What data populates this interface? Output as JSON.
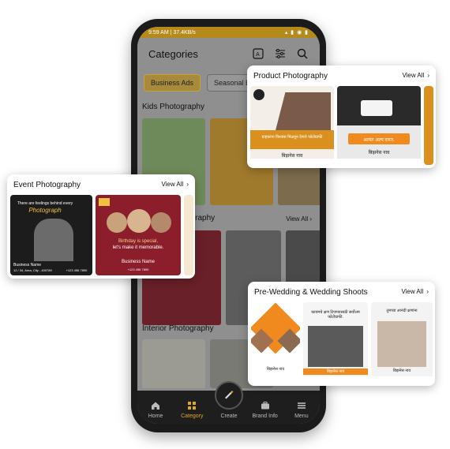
{
  "status": {
    "time": "9:59 AM | 37.4KB/s",
    "indicators": "▴ ▮ ◉ ▮"
  },
  "appbar": {
    "title": "Categories"
  },
  "chips": [
    {
      "label": "Business Ads"
    },
    {
      "label": "Seasonal B"
    }
  ],
  "sections": [
    {
      "title": "Kids Photography",
      "view_all": ""
    },
    {
      "title": "ography",
      "view_all": "View All"
    },
    {
      "title": "Interior Photography",
      "view_all": ""
    }
  ],
  "bottom_nav": [
    {
      "label": "Home",
      "icon": "home-icon"
    },
    {
      "label": "Category",
      "icon": "category-icon"
    },
    {
      "label": "Create",
      "icon": "create-icon"
    },
    {
      "label": "Brand Info",
      "icon": "briefcase-icon"
    },
    {
      "label": "Menu",
      "icon": "menu-icon"
    }
  ],
  "cards": {
    "product": {
      "title": "Product Photography",
      "view_all": "View All",
      "poster1_text": "ग्राहकांना विश्वास मिळवून देणारे फोटोग्राफी",
      "poster1_name": "बिझनेस नाव",
      "poster2_text": "अत्यंत अल्प दरात.",
      "poster2_name": "बिझनेस नाव"
    },
    "event": {
      "title": "Event Photography",
      "view_all": "View All",
      "poster1_top": "There are feelings behind every",
      "poster1_script": "Photograph",
      "poster1_name": "Business Name",
      "poster1_addr": "12 / 34, Area, City - 400789",
      "poster1_phone": "+123 456 7890",
      "poster2_line1": "Birthday is special,",
      "poster2_line2": "let's make it memorable.",
      "poster2_name": "Business Name",
      "poster2_phone": "+123 456 7890"
    },
    "wedding": {
      "title": "Pre-Wedding & Wedding Shoots",
      "view_all": "View All",
      "poster1_name": "बिझनेस नाव",
      "poster2_text": "कायमचे क्षण टिपण्यासाठी सर्वोत्तम फोटोग्राफी.",
      "poster2_name": "बिझनेस नाव",
      "poster3_text": "तुमच्या आनंदी क्षणांना",
      "poster3_name": "बिझनेस नाव"
    }
  },
  "colors": {
    "accent": "#e0a821",
    "nav_bg": "#1e1e1e",
    "orange": "#f08a1e",
    "maroon": "#8b1e2a"
  }
}
